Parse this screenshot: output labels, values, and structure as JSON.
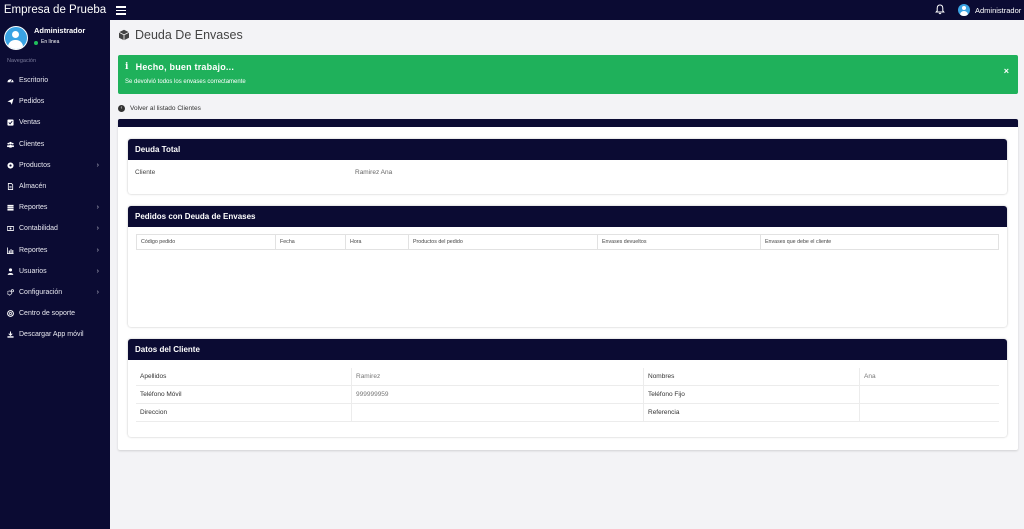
{
  "app": {
    "brand": "Empresa de Prueba"
  },
  "topbar": {
    "user_name": "Administrador"
  },
  "sidebar": {
    "user_name": "Administrador",
    "user_status": "En línea",
    "nav_header": "Navegación",
    "items": [
      {
        "label": "Escritorio",
        "icon": "dashboard-icon",
        "has_submenu": false
      },
      {
        "label": "Pedidos",
        "icon": "paper-plane-icon",
        "has_submenu": false
      },
      {
        "label": "Ventas",
        "icon": "check-square-icon",
        "has_submenu": false
      },
      {
        "label": "Clientes",
        "icon": "users-icon",
        "has_submenu": false
      },
      {
        "label": "Productos",
        "icon": "product-icon",
        "has_submenu": true
      },
      {
        "label": "Almacén",
        "icon": "document-icon",
        "has_submenu": false
      },
      {
        "label": "Reportes",
        "icon": "bars-icon",
        "has_submenu": true
      },
      {
        "label": "Contabilidad",
        "icon": "money-icon",
        "has_submenu": true
      },
      {
        "label": "Reportes",
        "icon": "chart-icon",
        "has_submenu": true
      },
      {
        "label": "Usuarios",
        "icon": "user-icon",
        "has_submenu": true
      },
      {
        "label": "Configuración",
        "icon": "gears-icon",
        "has_submenu": true
      },
      {
        "label": "Centro de soporte",
        "icon": "life-ring-icon",
        "has_submenu": false
      },
      {
        "label": "Descargar App móvil",
        "icon": "download-icon",
        "has_submenu": false
      }
    ]
  },
  "main": {
    "page_title": "Deuda De Envases",
    "alert": {
      "title": "Hecho, buen trabajo...",
      "message": "Se devolvió todos los envases correctamente",
      "close": "×"
    },
    "back_link": "Volver al listado Clientes",
    "deuda_total": {
      "title": "Deuda Total",
      "cliente_label": "Cliente",
      "cliente_value": "Ramirez Ana"
    },
    "pedidos": {
      "title": "Pedidos con Deuda de Envases",
      "columns": [
        "Código pedido",
        "Fecha",
        "Hora",
        "Productos del pedido",
        "Envases devueltos",
        "Envases que debe el cliente"
      ]
    },
    "datos_cliente": {
      "title": "Datos del Cliente",
      "rows": [
        {
          "label1": "Apellidos",
          "value1": "Ramirez",
          "label2": "Nombres",
          "value2": "Ana"
        },
        {
          "label1": "Teléfono Móvil",
          "value1": "999999959",
          "label2": "Teléfono Fijo",
          "value2": ""
        },
        {
          "label1": "Direccion",
          "value1": "",
          "label2": "Referencia",
          "value2": ""
        }
      ]
    }
  },
  "colors": {
    "navy": "#0b0b33",
    "success": "#1fb15b",
    "avatar": "#3aa3e3"
  }
}
